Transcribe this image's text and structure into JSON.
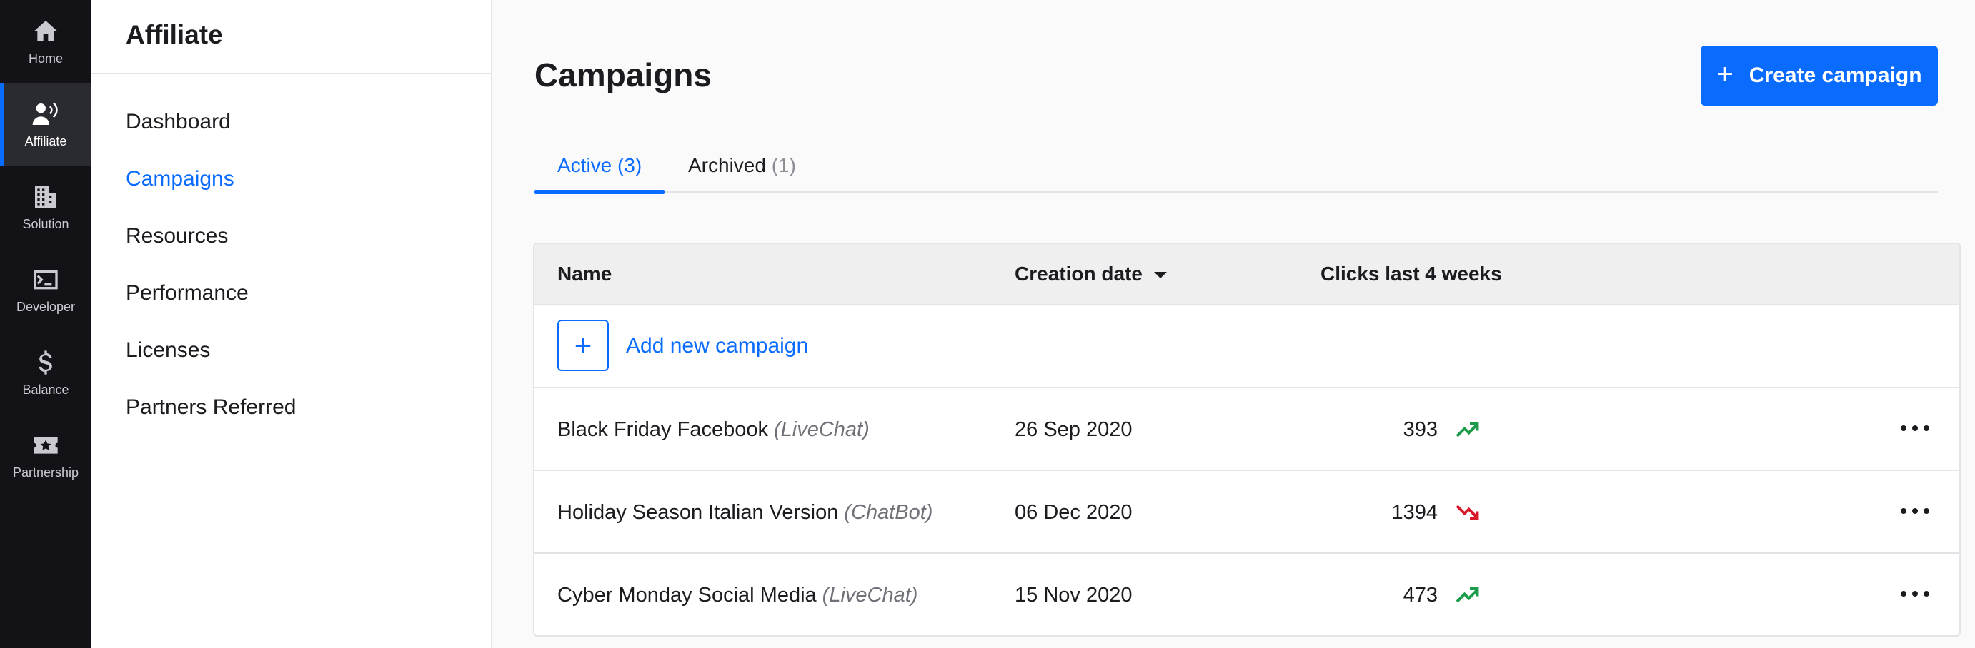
{
  "rail": {
    "items": [
      {
        "label": "Home",
        "icon": "home-icon"
      },
      {
        "label": "Affiliate",
        "icon": "affiliate-icon",
        "active": true
      },
      {
        "label": "Solution",
        "icon": "building-icon"
      },
      {
        "label": "Developer",
        "icon": "terminal-icon"
      },
      {
        "label": "Balance",
        "icon": "dollar-icon"
      },
      {
        "label": "Partnership",
        "icon": "ticket-star-icon"
      }
    ]
  },
  "subnav": {
    "title": "Affiliate",
    "items": [
      {
        "label": "Dashboard"
      },
      {
        "label": "Campaigns",
        "active": true
      },
      {
        "label": "Resources"
      },
      {
        "label": "Performance"
      },
      {
        "label": "Licenses"
      },
      {
        "label": "Partners Referred"
      }
    ]
  },
  "main": {
    "title": "Campaigns",
    "create_button": {
      "plus": "+",
      "label": "Create campaign"
    },
    "tabs": [
      {
        "label": "Active",
        "count": "(3)",
        "active": true
      },
      {
        "label": "Archived",
        "count": "(1)"
      }
    ],
    "table": {
      "columns": {
        "name": "Name",
        "created": "Creation date",
        "clicks": "Clicks last 4 weeks"
      },
      "add_row": {
        "plus": "+",
        "label": "Add new campaign"
      },
      "rows": [
        {
          "name": "Black Friday Facebook",
          "product": "(LiveChat)",
          "date": "26 Sep 2020",
          "clicks": "393",
          "trend": "up"
        },
        {
          "name": "Holiday Season Italian Version",
          "product": "(ChatBot)",
          "date": "06 Dec 2020",
          "clicks": "1394",
          "trend": "down"
        },
        {
          "name": "Cyber Monday Social Media",
          "product": "(LiveChat)",
          "date": "15 Nov 2020",
          "clicks": "473",
          "trend": "up"
        }
      ]
    }
  },
  "colors": {
    "accent": "#0a6cff",
    "rail_bg": "#131317",
    "trend_up": "#1c9b4a",
    "trend_down": "#d9182b"
  }
}
